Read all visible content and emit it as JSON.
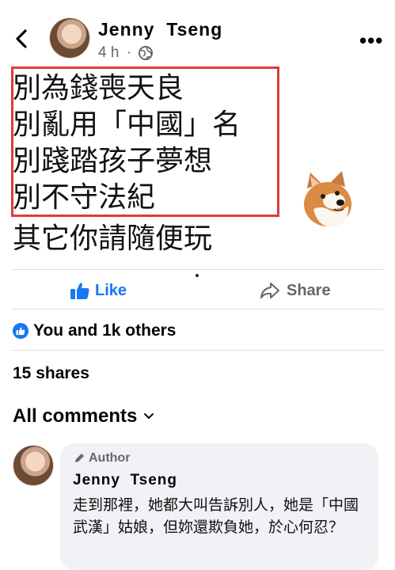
{
  "header": {
    "author_name": "Jenny  Tseng",
    "time": "4 h",
    "separator": "·",
    "audience_icon": "globe-icon",
    "more_icon": "more-icon",
    "more_label": "•••"
  },
  "post": {
    "lines": [
      "別為錢喪天良",
      "別亂用「中國」名",
      "別踐踏孩子夢想",
      "別不守法紀",
      "其它你請隨便玩"
    ],
    "highlight_color": "#e03a3a"
  },
  "actions": {
    "like_label": "Like",
    "share_label": "Share",
    "accent": "#1877f2"
  },
  "reactions": {
    "summary": "You and 1k others",
    "shares": "15 shares"
  },
  "comments": {
    "header": "All comments",
    "items": [
      {
        "badge": "Author",
        "name": "Jenny  Tseng",
        "text": "走到那裡，她都大叫告訴別人，她是「中國武漢」姑娘，但妳還欺負她，於心何忍？"
      }
    ]
  }
}
